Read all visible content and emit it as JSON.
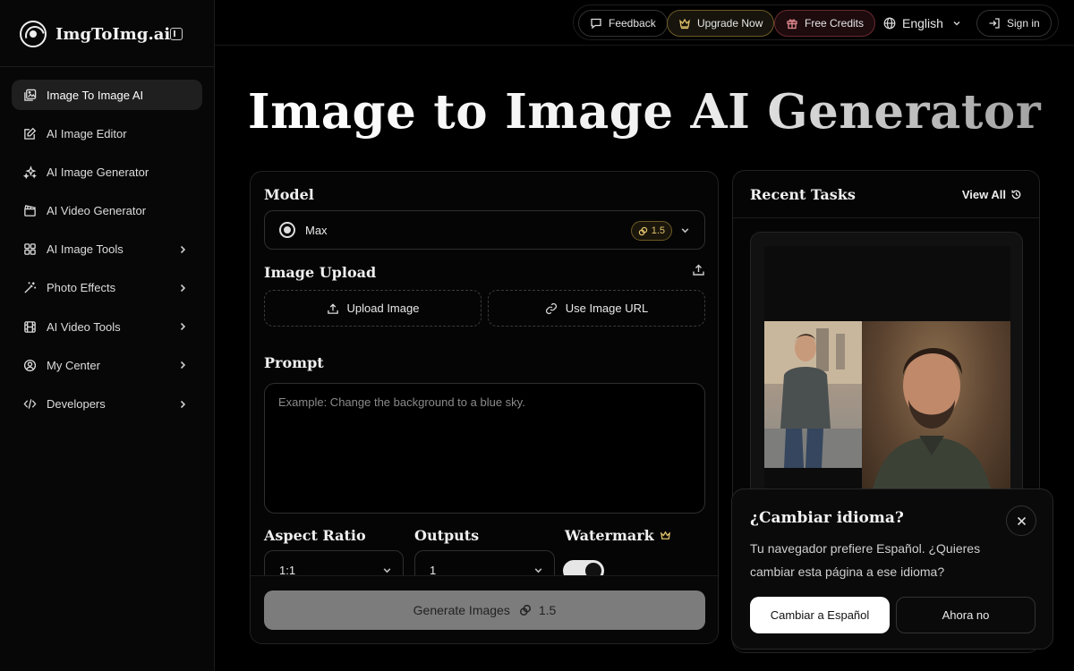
{
  "brand": {
    "name": "ImgToImg.ai"
  },
  "sidebar": {
    "items": [
      {
        "label": "Image To Image AI",
        "icon": "image-stack-icon",
        "active": true,
        "has_submenu": false
      },
      {
        "label": "AI Image Editor",
        "icon": "edit-icon",
        "active": false,
        "has_submenu": false
      },
      {
        "label": "AI Image Generator",
        "icon": "sparkles-icon",
        "active": false,
        "has_submenu": false
      },
      {
        "label": "AI Video Generator",
        "icon": "clapperboard-icon",
        "active": false,
        "has_submenu": false
      },
      {
        "label": "AI Image Tools",
        "icon": "grid-icon",
        "active": false,
        "has_submenu": true
      },
      {
        "label": "Photo Effects",
        "icon": "magic-wand-icon",
        "active": false,
        "has_submenu": true
      },
      {
        "label": "AI Video Tools",
        "icon": "film-icon",
        "active": false,
        "has_submenu": true
      },
      {
        "label": "My Center",
        "icon": "user-circle-icon",
        "active": false,
        "has_submenu": true
      },
      {
        "label": "Developers",
        "icon": "code-icon",
        "active": false,
        "has_submenu": true
      }
    ]
  },
  "topbar": {
    "feedback": "Feedback",
    "upgrade": "Upgrade Now",
    "credits": "Free Credits",
    "language": "English",
    "signin": "Sign in"
  },
  "page": {
    "title": "Image to Image AI Generator"
  },
  "form": {
    "model_label": "Model",
    "model_value": "Max",
    "model_cost": "1.5",
    "upload_label": "Image Upload",
    "upload_button": "Upload Image",
    "url_button": "Use Image URL",
    "prompt_label": "Prompt",
    "prompt_placeholder": "Example: Change the background to a blue sky.",
    "aspect_label": "Aspect Ratio",
    "aspect_value": "1:1",
    "outputs_label": "Outputs",
    "outputs_value": "1",
    "watermark_label": "Watermark",
    "watermark_on": true,
    "generate_label": "Generate Images",
    "generate_cost": "1.5"
  },
  "recent": {
    "title": "Recent Tasks",
    "view_all": "View All"
  },
  "lang_popup": {
    "title": "¿Cambiar idioma?",
    "body": "Tu navegador prefiere Español. ¿Quieres cambiar esta página a ese idioma?",
    "accept": "Cambiar a Español",
    "decline": "Ahora no"
  },
  "colors": {
    "background": "#000000",
    "upgrade_accent": "#e2c36a",
    "credits_accent": "#6b2a2e",
    "generate_button": "#7c7c7c"
  }
}
